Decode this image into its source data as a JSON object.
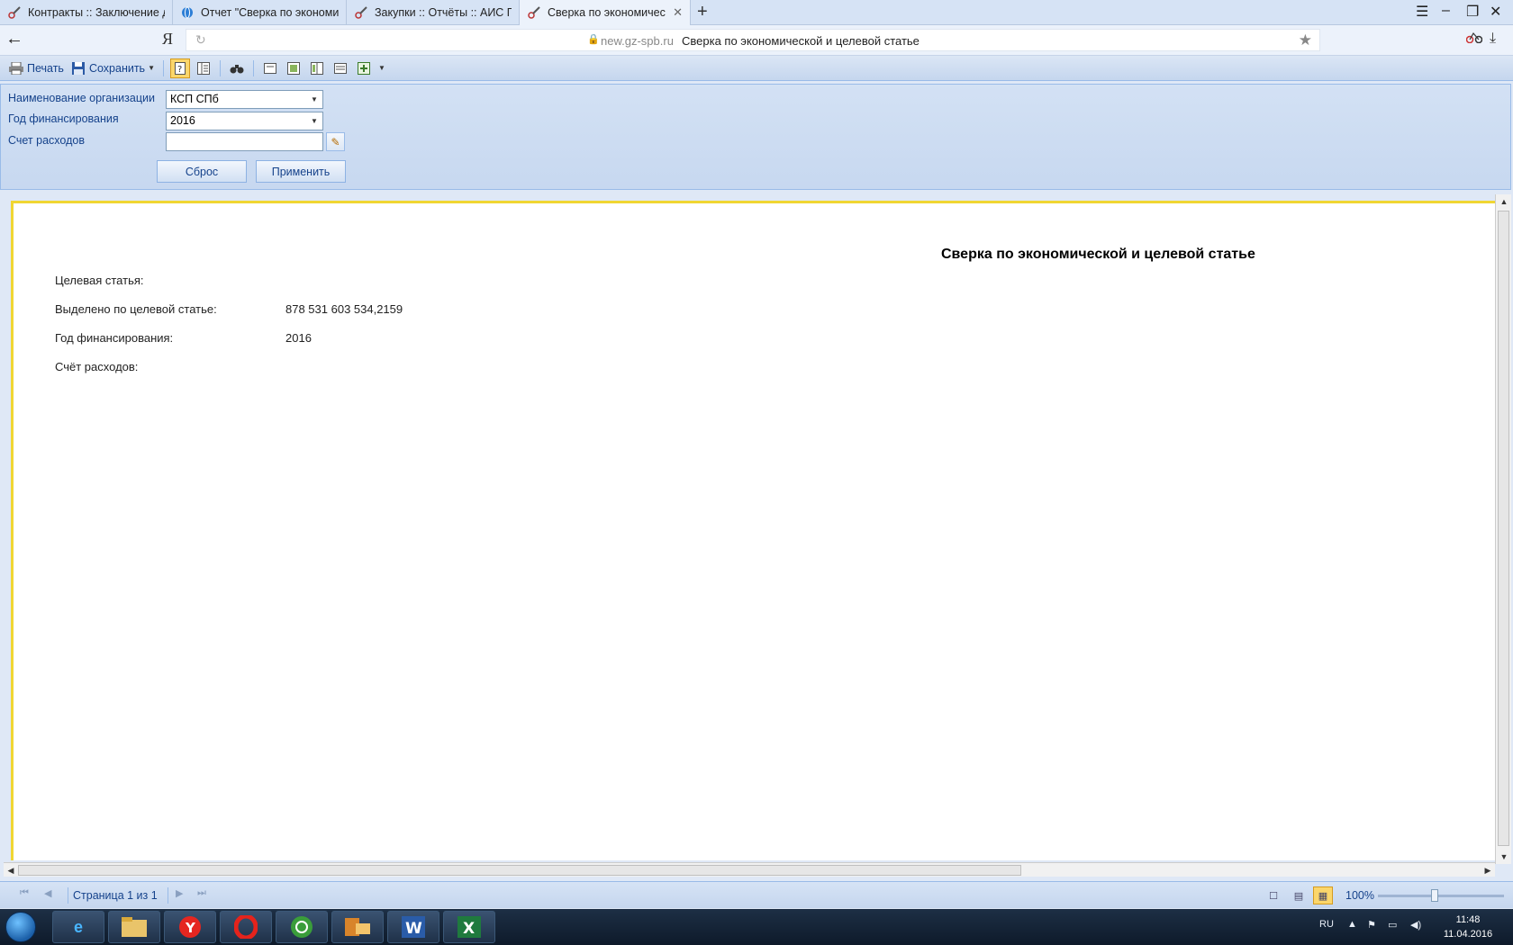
{
  "browser": {
    "tabs": [
      {
        "label": "Контракты :: Заключение до",
        "icon": "tools-icon",
        "active": false
      },
      {
        "label": "Отчет \"Сверка по экономич",
        "icon": "globe-icon",
        "active": false
      },
      {
        "label": "Закупки :: Отчёты :: АИС ГЗ",
        "icon": "tools-icon",
        "active": false
      },
      {
        "label": "Сверка по экономическ",
        "icon": "tools-icon",
        "active": true
      }
    ],
    "new_tab": "+",
    "yandex_glyph": "Я",
    "host": "new.gz-spb.ru",
    "page_title": "Сверка по экономической и целевой статье"
  },
  "toolbar": {
    "print_label": "Печать",
    "save_label": "Сохранить"
  },
  "filter": {
    "org_label": "Наименование организации",
    "org_value": "КСП СПб",
    "year_label": "Год финансирования",
    "year_value": "2016",
    "account_label": "Счет расходов",
    "account_value": "",
    "reset_label": "Сброс",
    "apply_label": "Применить"
  },
  "report": {
    "title": "Сверка по экономической и целевой статье",
    "rows": [
      {
        "label": "Целевая статья:",
        "value": ""
      },
      {
        "label": "Выделено по целевой статье:",
        "value": "878 531 603 534,2159"
      },
      {
        "label": "Год финансирования:",
        "value": "2016"
      },
      {
        "label": "Счёт расходов:",
        "value": ""
      }
    ]
  },
  "pager": {
    "page_text": "Страница 1 из 1",
    "zoom": "100%",
    "zoom_level_percent": 45
  },
  "taskbar": {
    "apps": [
      "ie-icon",
      "explorer-icon",
      "yandex-icon",
      "opera-icon",
      "messenger-icon",
      "outlook-icon",
      "word-icon",
      "excel-icon"
    ],
    "lang": "RU",
    "time": "11:48",
    "date": "11.04.2016"
  }
}
